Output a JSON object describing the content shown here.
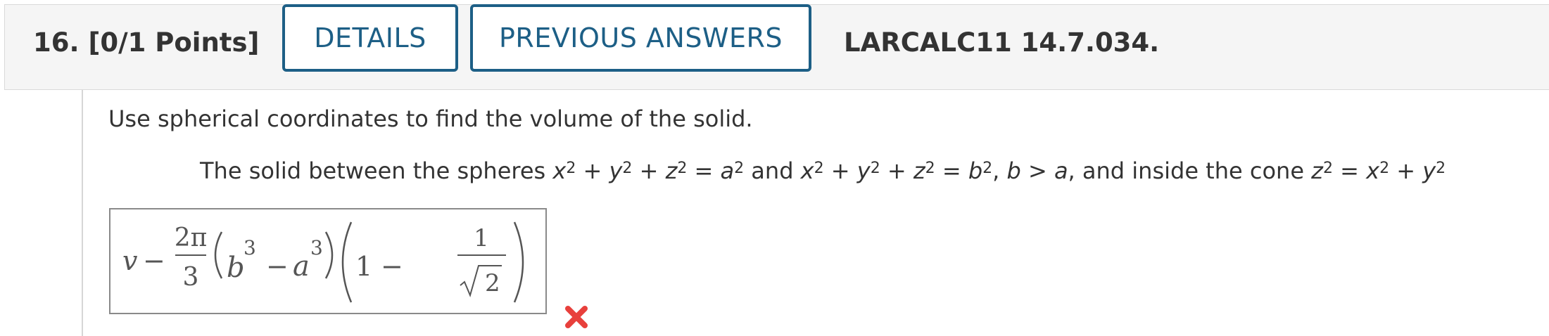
{
  "question": {
    "number_label": "16.",
    "points": "[0/1 Points]",
    "details_button": "DETAILS",
    "previous_answers_button": "PREVIOUS ANSWERS",
    "reference": "LARCALC11 14.7.034."
  },
  "body": {
    "prompt": "Use spherical coordinates to find the volume of the solid.",
    "statement": {
      "t1": "The solid between the spheres ",
      "t2": "and ",
      "t3": ", ",
      "t4": " > ",
      "t5": ", and inside the cone "
    }
  },
  "answer": {
    "lhs_var": "v",
    "lhs_op": "−",
    "frac_num": "2π",
    "frac_den": "3",
    "b": "b",
    "a": "a",
    "exp": "3",
    "minus": "−",
    "one": "1",
    "num_one": "1",
    "sqrt_arg": "2",
    "status_icon": "incorrect-x-icon"
  },
  "colors": {
    "button_border": "#1d5f86",
    "header_bg": "#f5f5f5",
    "incorrect": "#e8403c"
  }
}
